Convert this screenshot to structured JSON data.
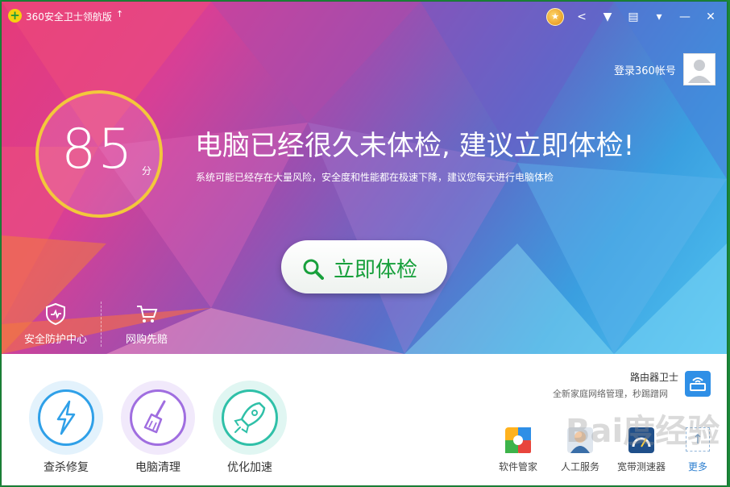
{
  "app": {
    "title": "360安全卫士领航版",
    "logo_glyph": "+",
    "upgrade_glyph": "↑"
  },
  "titlebar": {
    "icons": [
      {
        "name": "medal-icon",
        "glyph": "★"
      },
      {
        "name": "share-icon",
        "glyph": "<"
      },
      {
        "name": "skin-icon",
        "glyph": "▼"
      },
      {
        "name": "feedback-icon",
        "glyph": "▤"
      },
      {
        "name": "menu-icon",
        "glyph": "▾"
      },
      {
        "name": "minimize-icon",
        "glyph": "—"
      },
      {
        "name": "close-icon",
        "glyph": "✕"
      }
    ]
  },
  "login": {
    "label": "登录360帐号"
  },
  "score": {
    "value": "85",
    "unit": "分"
  },
  "headline": "电脑已经很久未体检, 建议立即体检!",
  "subline": "系统可能已经存在大量风险，安全度和性能都在极速下降，建议您每天进行电脑体检",
  "scan_button": {
    "label": "立即体检"
  },
  "quick_items": [
    {
      "label": "安全防护中心",
      "icon": "shield-icon"
    },
    {
      "label": "网购先赔",
      "icon": "cart-icon"
    }
  ],
  "tools": [
    {
      "label": "查杀修复",
      "icon": "lightning-icon",
      "color": "#2fa0e8"
    },
    {
      "label": "电脑清理",
      "icon": "broom-icon",
      "color": "#a06ee0"
    },
    {
      "label": "优化加速",
      "icon": "rocket-icon",
      "color": "#2fc0a8"
    }
  ],
  "router": {
    "title": "路由器卫士",
    "subtitle": "全新家庭网络管理，秒踢蹭网"
  },
  "apps": [
    {
      "label": "软件管家",
      "icon": "software-manager-icon"
    },
    {
      "label": "人工服务",
      "icon": "support-icon"
    },
    {
      "label": "宽带测速器",
      "icon": "speedtest-icon"
    }
  ],
  "more": {
    "label": "更多",
    "glyph": "↑"
  },
  "watermark": "Bai度经验",
  "colors": {
    "brand_green": "#18a03c",
    "score_ring": "#f3c83b",
    "link_blue": "#2f80d0"
  }
}
